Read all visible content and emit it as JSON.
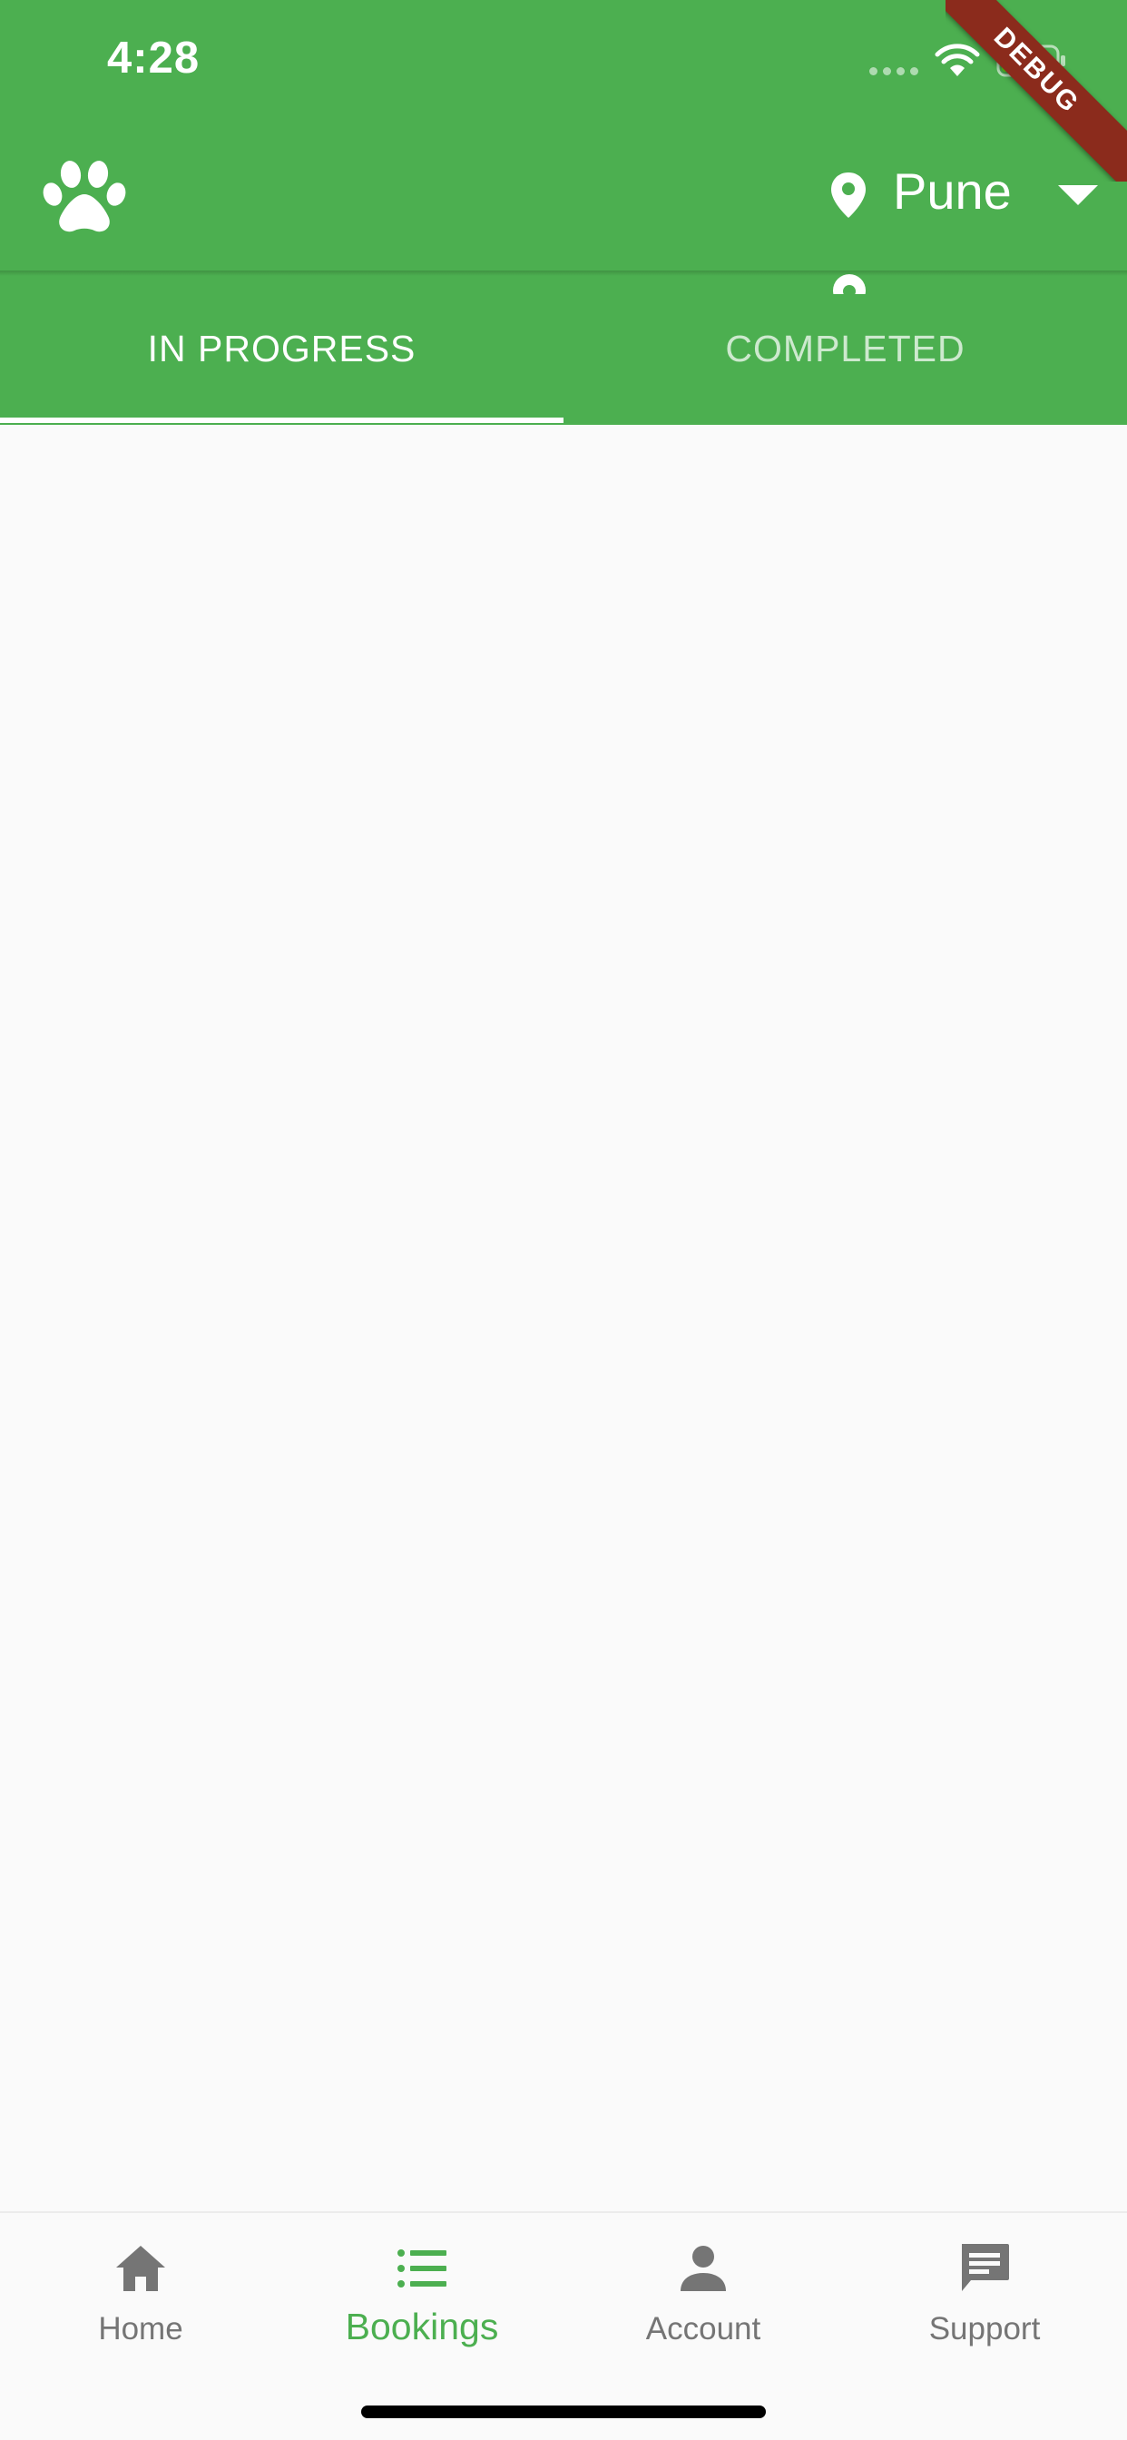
{
  "status_bar": {
    "time": "4:28",
    "icons": [
      "cellular-signal-icon",
      "wifi-icon",
      "battery-charging-icon"
    ]
  },
  "app_bar": {
    "logo_icon": "paw-icon",
    "location_icon": "location-pin-icon",
    "city": "Pune",
    "dropdown_icon": "caret-down-icon"
  },
  "tabs": [
    {
      "label": "IN PROGRESS",
      "selected": true
    },
    {
      "label": "COMPLETED",
      "selected": false
    }
  ],
  "debug_banner": "DEBUG",
  "bottom_nav": {
    "items": [
      {
        "label": "Home",
        "icon": "home-icon",
        "selected": false
      },
      {
        "label": "Bookings",
        "icon": "list-icon",
        "selected": true
      },
      {
        "label": "Account",
        "icon": "person-icon",
        "selected": false
      },
      {
        "label": "Support",
        "icon": "chat-icon",
        "selected": false
      }
    ]
  },
  "colors": {
    "primary": "#4caf50",
    "background": "#fafafa",
    "inactive_nav": "#757575",
    "debug_ribbon": "#8b2b1c"
  }
}
